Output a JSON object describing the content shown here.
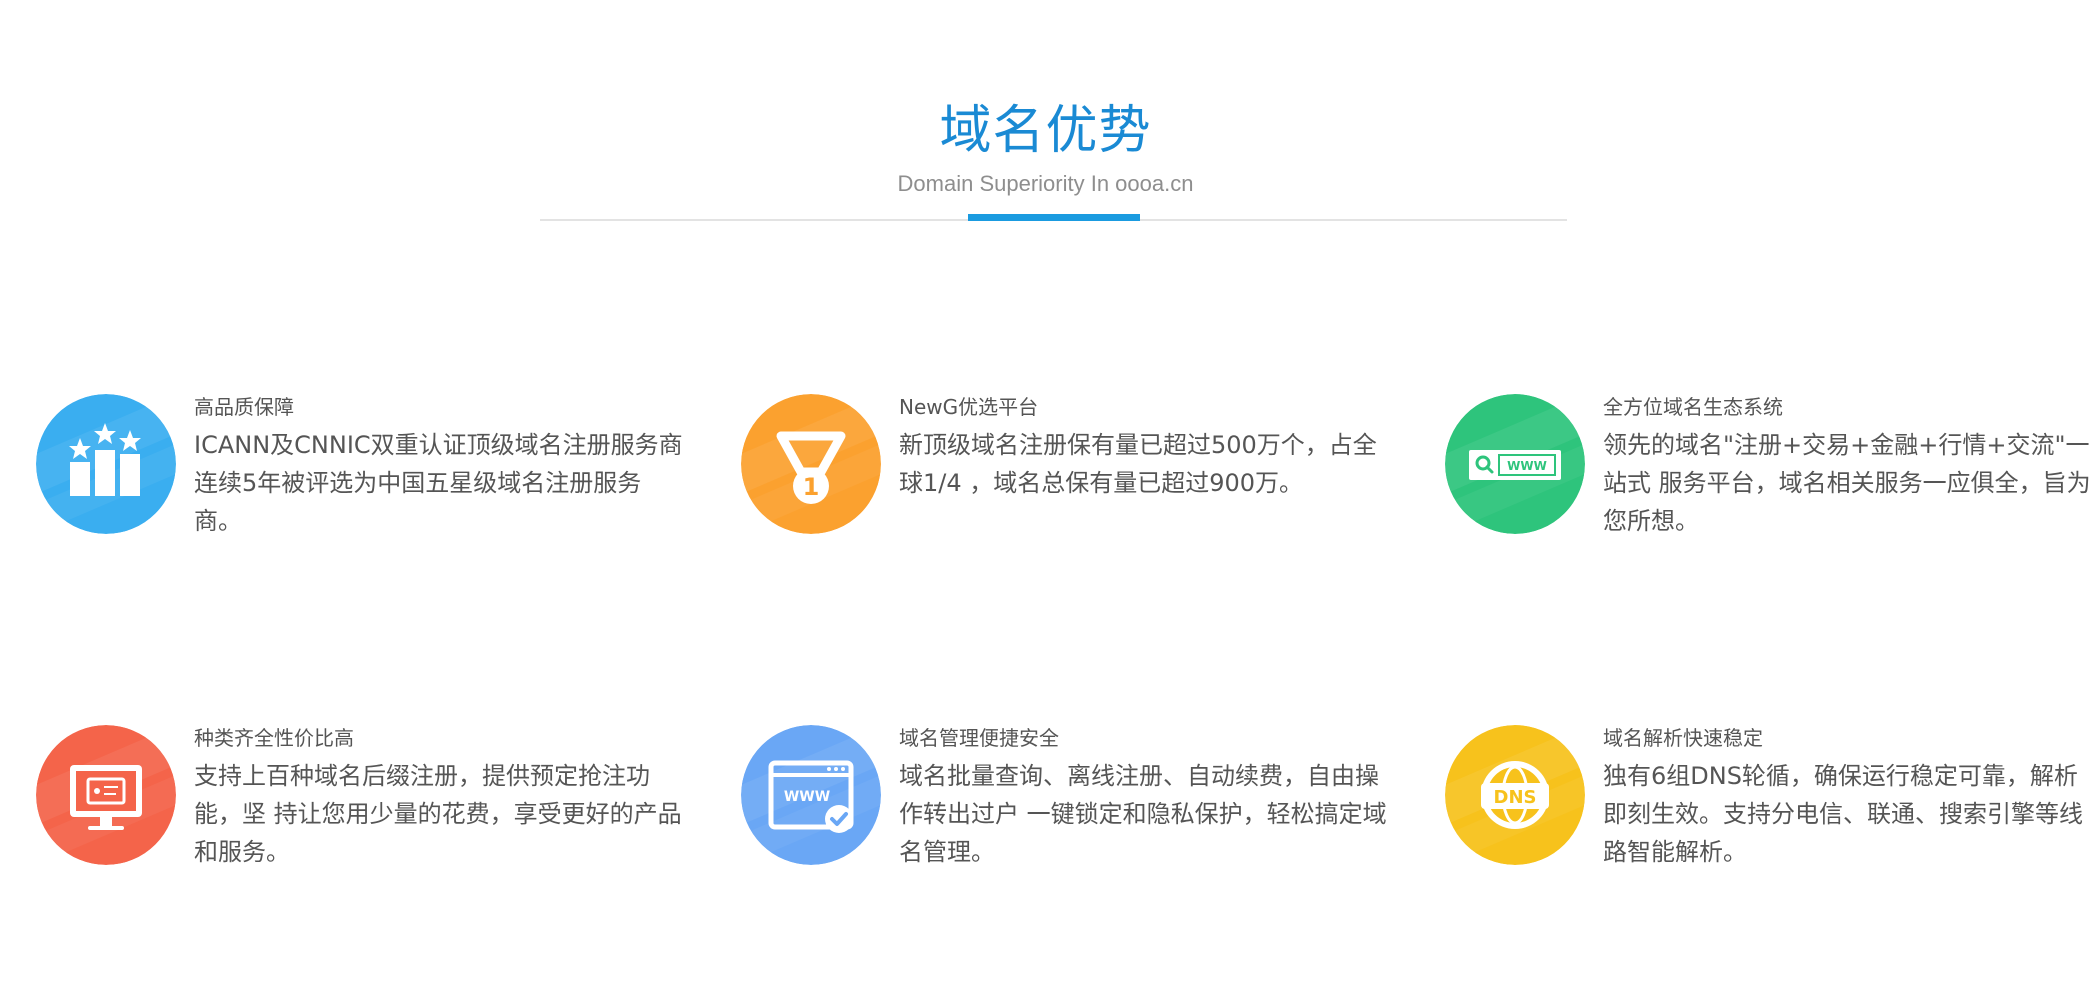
{
  "header": {
    "title": "域名优势",
    "subtitle": "Domain Superiority In oooa.cn"
  },
  "features": [
    {
      "title": "高品质保障",
      "desc": "ICANN及CNNIC双重认证顶级域名注册服务商 连续5年被评选为中国五星级域名注册服务商。",
      "icon": "award-bars-icon",
      "color": "#3aaef0"
    },
    {
      "title": "NewG优选平台",
      "desc": "新顶级域名注册保有量已超过500万个，占全球1/4 ，域名总保有量已超过900万。",
      "icon": "medal-icon",
      "color": "#fba12f"
    },
    {
      "title": "全方位域名生态系统",
      "desc": "领先的域名\"注册+交易+金融+行情+交流\"一站式 服务平台，域名相关服务一应俱全，旨为您所想。",
      "icon": "www-search-icon",
      "color": "#2ec47c",
      "icon_text": "WWW"
    },
    {
      "title": "种类齐全性价比高",
      "desc": "支持上百种域名后缀注册，提供预定抢注功能，坚 持让您用少量的花费，享受更好的产品和服务。",
      "icon": "monitor-icon",
      "color": "#f4644a"
    },
    {
      "title": "域名管理便捷安全",
      "desc": "域名批量查询、离线注册、自动续费，自由操作转出过户 一键锁定和隐私保护，轻松搞定域名管理。",
      "icon": "browser-www-check-icon",
      "color": "#6aa7f5",
      "icon_text": "WWW"
    },
    {
      "title": "域名解析快速稳定",
      "desc": "独有6组DNS轮循，确保运行稳定可靠，解析即刻生效。支持分电信、联通、搜索引擎等线路智能解析。",
      "icon": "dns-globe-icon",
      "color": "#f7c21c",
      "icon_text": "DNS"
    }
  ]
}
